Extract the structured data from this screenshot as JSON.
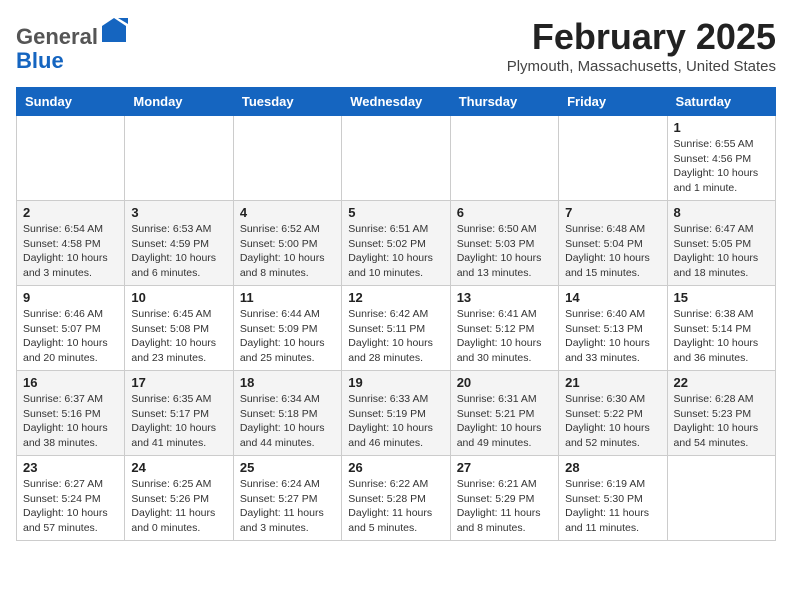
{
  "header": {
    "logo_general": "General",
    "logo_blue": "Blue",
    "month_year": "February 2025",
    "location": "Plymouth, Massachusetts, United States"
  },
  "days_of_week": [
    "Sunday",
    "Monday",
    "Tuesday",
    "Wednesday",
    "Thursday",
    "Friday",
    "Saturday"
  ],
  "weeks": [
    [
      {
        "day": "",
        "info": ""
      },
      {
        "day": "",
        "info": ""
      },
      {
        "day": "",
        "info": ""
      },
      {
        "day": "",
        "info": ""
      },
      {
        "day": "",
        "info": ""
      },
      {
        "day": "",
        "info": ""
      },
      {
        "day": "1",
        "info": "Sunrise: 6:55 AM\nSunset: 4:56 PM\nDaylight: 10 hours and 1 minute."
      }
    ],
    [
      {
        "day": "2",
        "info": "Sunrise: 6:54 AM\nSunset: 4:58 PM\nDaylight: 10 hours and 3 minutes."
      },
      {
        "day": "3",
        "info": "Sunrise: 6:53 AM\nSunset: 4:59 PM\nDaylight: 10 hours and 6 minutes."
      },
      {
        "day": "4",
        "info": "Sunrise: 6:52 AM\nSunset: 5:00 PM\nDaylight: 10 hours and 8 minutes."
      },
      {
        "day": "5",
        "info": "Sunrise: 6:51 AM\nSunset: 5:02 PM\nDaylight: 10 hours and 10 minutes."
      },
      {
        "day": "6",
        "info": "Sunrise: 6:50 AM\nSunset: 5:03 PM\nDaylight: 10 hours and 13 minutes."
      },
      {
        "day": "7",
        "info": "Sunrise: 6:48 AM\nSunset: 5:04 PM\nDaylight: 10 hours and 15 minutes."
      },
      {
        "day": "8",
        "info": "Sunrise: 6:47 AM\nSunset: 5:05 PM\nDaylight: 10 hours and 18 minutes."
      }
    ],
    [
      {
        "day": "9",
        "info": "Sunrise: 6:46 AM\nSunset: 5:07 PM\nDaylight: 10 hours and 20 minutes."
      },
      {
        "day": "10",
        "info": "Sunrise: 6:45 AM\nSunset: 5:08 PM\nDaylight: 10 hours and 23 minutes."
      },
      {
        "day": "11",
        "info": "Sunrise: 6:44 AM\nSunset: 5:09 PM\nDaylight: 10 hours and 25 minutes."
      },
      {
        "day": "12",
        "info": "Sunrise: 6:42 AM\nSunset: 5:11 PM\nDaylight: 10 hours and 28 minutes."
      },
      {
        "day": "13",
        "info": "Sunrise: 6:41 AM\nSunset: 5:12 PM\nDaylight: 10 hours and 30 minutes."
      },
      {
        "day": "14",
        "info": "Sunrise: 6:40 AM\nSunset: 5:13 PM\nDaylight: 10 hours and 33 minutes."
      },
      {
        "day": "15",
        "info": "Sunrise: 6:38 AM\nSunset: 5:14 PM\nDaylight: 10 hours and 36 minutes."
      }
    ],
    [
      {
        "day": "16",
        "info": "Sunrise: 6:37 AM\nSunset: 5:16 PM\nDaylight: 10 hours and 38 minutes."
      },
      {
        "day": "17",
        "info": "Sunrise: 6:35 AM\nSunset: 5:17 PM\nDaylight: 10 hours and 41 minutes."
      },
      {
        "day": "18",
        "info": "Sunrise: 6:34 AM\nSunset: 5:18 PM\nDaylight: 10 hours and 44 minutes."
      },
      {
        "day": "19",
        "info": "Sunrise: 6:33 AM\nSunset: 5:19 PM\nDaylight: 10 hours and 46 minutes."
      },
      {
        "day": "20",
        "info": "Sunrise: 6:31 AM\nSunset: 5:21 PM\nDaylight: 10 hours and 49 minutes."
      },
      {
        "day": "21",
        "info": "Sunrise: 6:30 AM\nSunset: 5:22 PM\nDaylight: 10 hours and 52 minutes."
      },
      {
        "day": "22",
        "info": "Sunrise: 6:28 AM\nSunset: 5:23 PM\nDaylight: 10 hours and 54 minutes."
      }
    ],
    [
      {
        "day": "23",
        "info": "Sunrise: 6:27 AM\nSunset: 5:24 PM\nDaylight: 10 hours and 57 minutes."
      },
      {
        "day": "24",
        "info": "Sunrise: 6:25 AM\nSunset: 5:26 PM\nDaylight: 11 hours and 0 minutes."
      },
      {
        "day": "25",
        "info": "Sunrise: 6:24 AM\nSunset: 5:27 PM\nDaylight: 11 hours and 3 minutes."
      },
      {
        "day": "26",
        "info": "Sunrise: 6:22 AM\nSunset: 5:28 PM\nDaylight: 11 hours and 5 minutes."
      },
      {
        "day": "27",
        "info": "Sunrise: 6:21 AM\nSunset: 5:29 PM\nDaylight: 11 hours and 8 minutes."
      },
      {
        "day": "28",
        "info": "Sunrise: 6:19 AM\nSunset: 5:30 PM\nDaylight: 11 hours and 11 minutes."
      },
      {
        "day": "",
        "info": ""
      }
    ]
  ]
}
